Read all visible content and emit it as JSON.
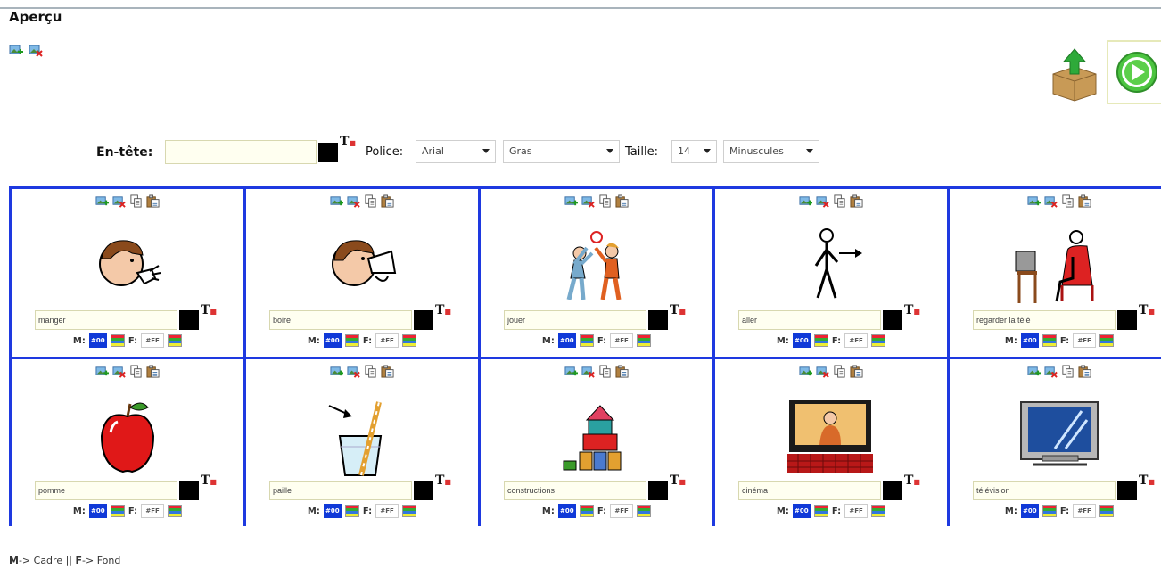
{
  "page": {
    "title": "Aperçu"
  },
  "header": {
    "label": "En-tête:",
    "value": "",
    "font_label": "Police:",
    "font_value": "Arial",
    "style_value": "Gras",
    "size_label": "Taille:",
    "size_value": "14",
    "case_value": "Minuscules",
    "t_glyph": "T"
  },
  "cell_controls": {
    "m_label": "M:",
    "f_label": "F:",
    "m_swatch_text": "#00",
    "f_swatch_text": "#FF"
  },
  "cells": [
    {
      "label": "manger",
      "picture": "person-eating-icon"
    },
    {
      "label": "boire",
      "picture": "person-drinking-icon"
    },
    {
      "label": "jouer",
      "picture": "children-playing-icon"
    },
    {
      "label": "aller",
      "picture": "person-walking-icon"
    },
    {
      "label": "regarder la télé",
      "picture": "person-watching-tv-icon"
    },
    {
      "label": "pomme",
      "picture": "apple-icon"
    },
    {
      "label": "paille",
      "picture": "straw-glass-icon"
    },
    {
      "label": "constructions",
      "picture": "toy-blocks-icon"
    },
    {
      "label": "cinéma",
      "picture": "cinema-icon"
    },
    {
      "label": "télévision",
      "picture": "television-icon"
    }
  ],
  "legend": {
    "m_key": "M",
    "m_text": "-> Cadre || ",
    "f_key": "F",
    "f_text": "-> Fond"
  },
  "colors": {
    "grid_border": "#1e39e0",
    "swatch_blue": "#1039d8",
    "input_bg": "#fffff0"
  }
}
